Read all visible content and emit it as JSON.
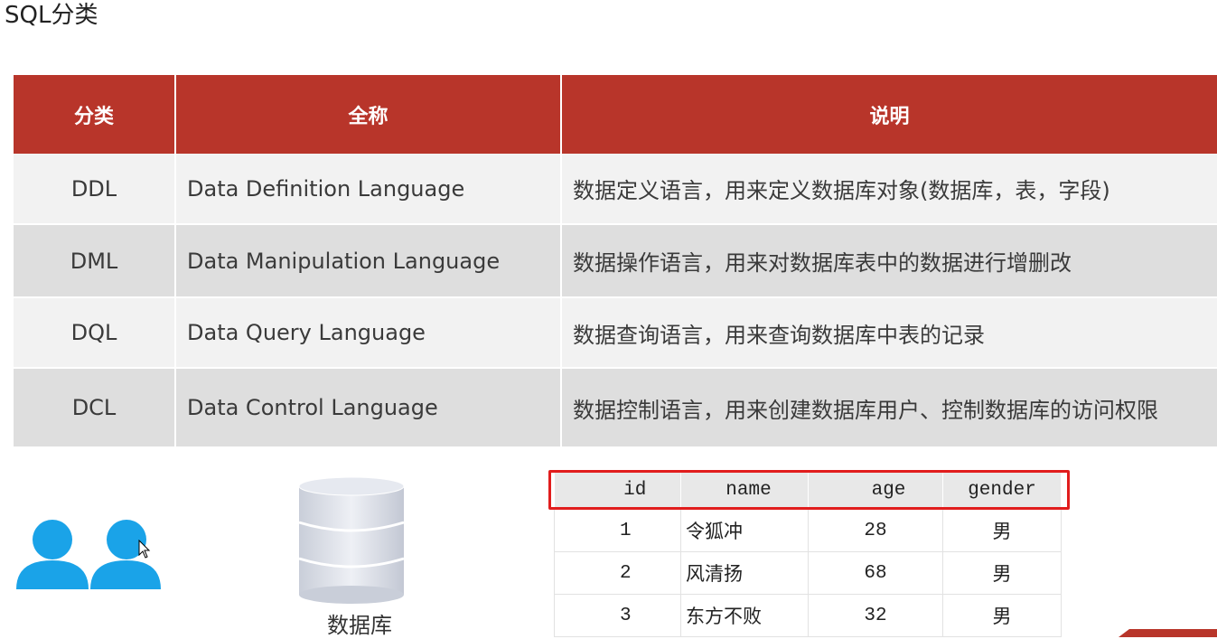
{
  "title": "SQL分类",
  "sql_table": {
    "headers": [
      "分类",
      "全称",
      "说明"
    ],
    "rows": [
      {
        "category": "DDL",
        "full_name": "Data Definition Language",
        "description": "数据定义语言，用来定义数据库对象(数据库，表，字段)"
      },
      {
        "category": "DML",
        "full_name": "Data Manipulation Language",
        "description": "数据操作语言，用来对数据库表中的数据进行增删改"
      },
      {
        "category": "DQL",
        "full_name": "Data Query Language",
        "description": "数据查询语言，用来查询数据库中表的记录"
      },
      {
        "category": "DCL",
        "full_name": "Data Control Language",
        "description": "数据控制语言，用来创建数据库用户、控制数据库的访问权限"
      }
    ]
  },
  "database_label": "数据库",
  "sample_table": {
    "headers": [
      "id",
      "name",
      "age",
      "gender"
    ],
    "rows": [
      {
        "id": "1",
        "name": "令狐冲",
        "age": "28",
        "gender": "男"
      },
      {
        "id": "2",
        "name": "风清扬",
        "age": "68",
        "gender": "男"
      },
      {
        "id": "3",
        "name": "东方不败",
        "age": "32",
        "gender": "男"
      }
    ]
  },
  "colors": {
    "header_red": "#b8352a",
    "highlight_red": "#e11d1d",
    "user_icon_blue": "#1aa3e8",
    "database_gray": "#d5d9e3"
  },
  "icons": [
    "users-icon",
    "database-icon",
    "mouse-cursor-icon"
  ]
}
